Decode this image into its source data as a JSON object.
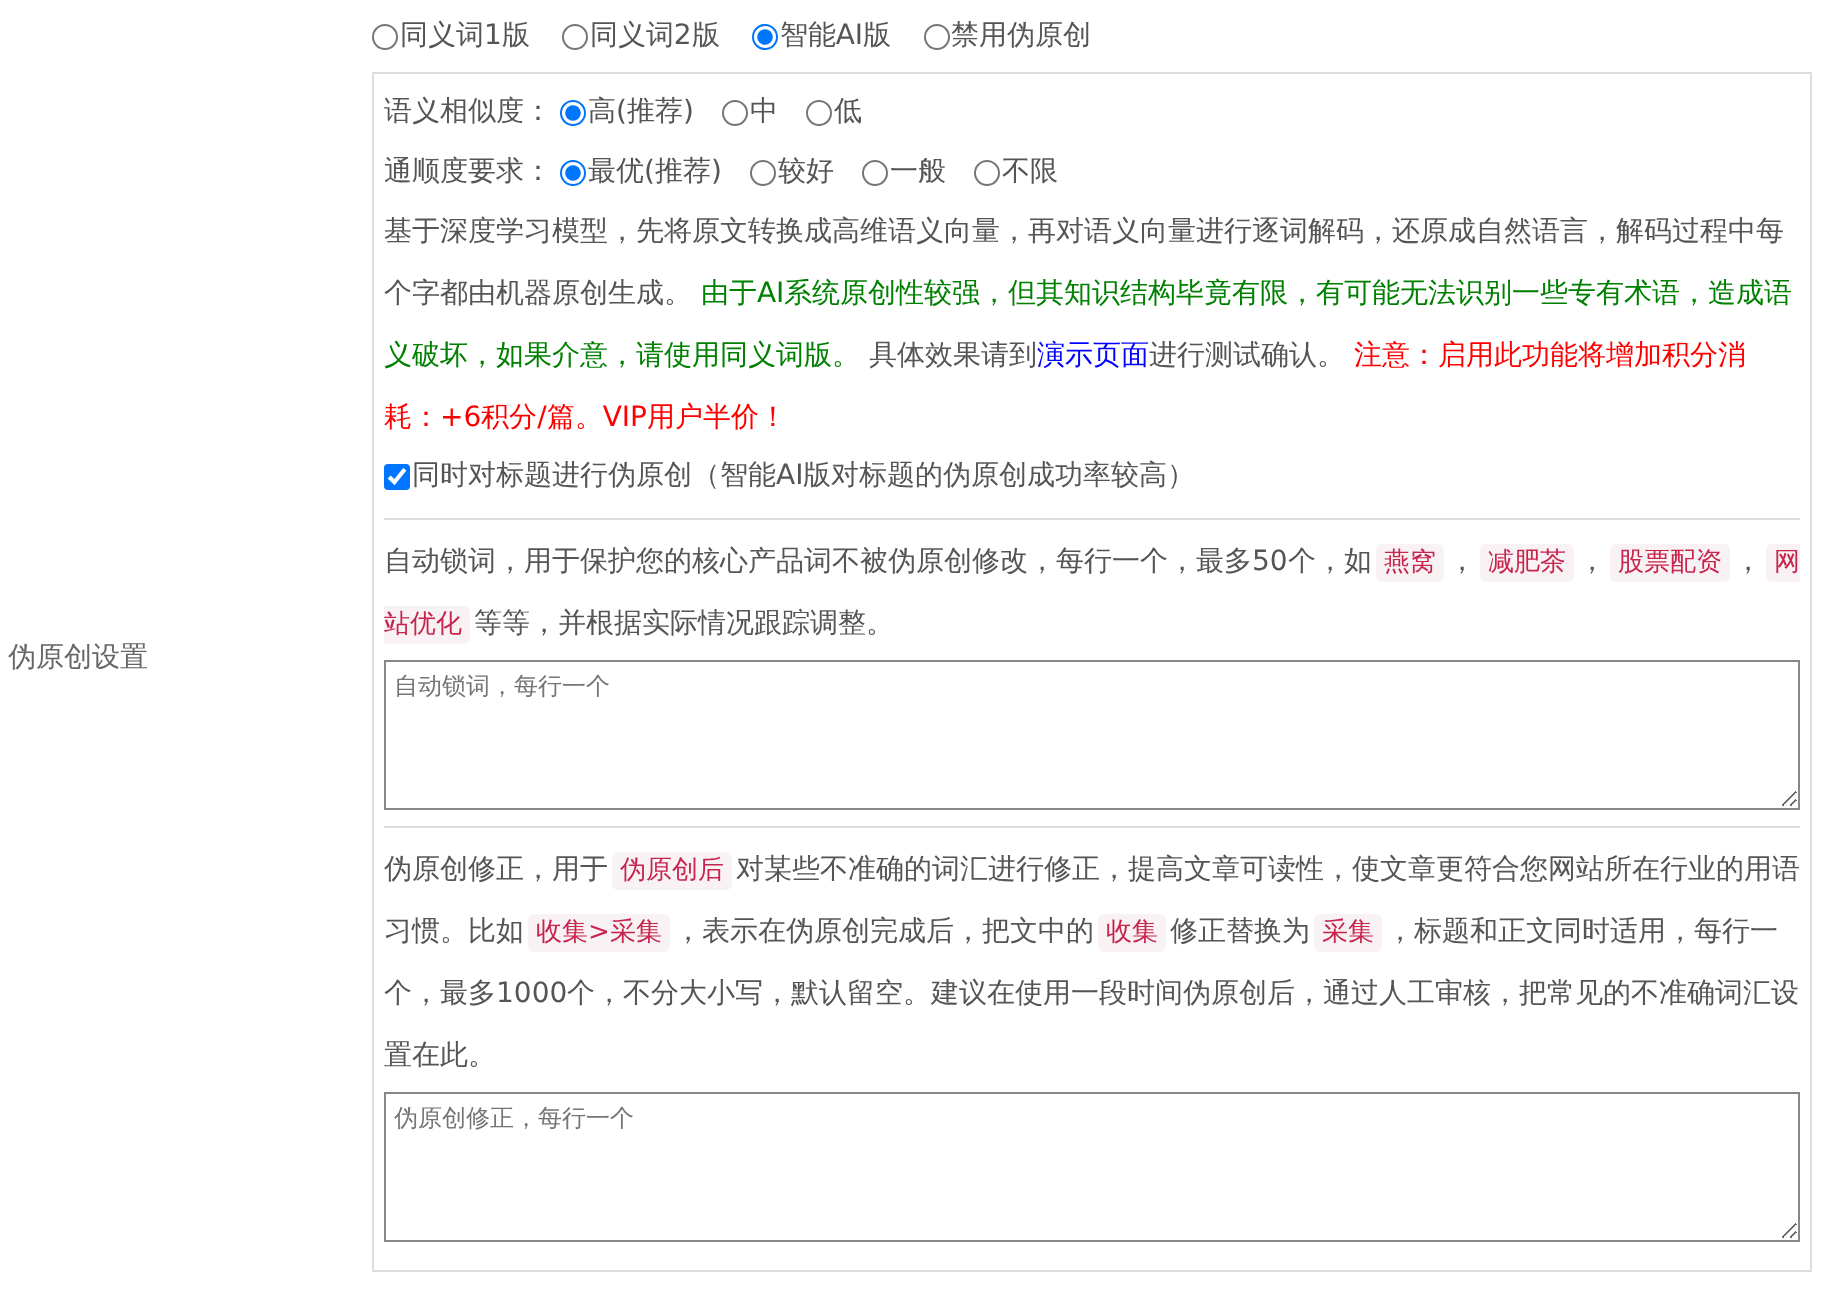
{
  "section_label": "伪原创设置",
  "modes": [
    {
      "label": "同义词1版",
      "selected": false
    },
    {
      "label": "同义词2版",
      "selected": false
    },
    {
      "label": "智能AI版",
      "selected": true
    },
    {
      "label": "禁用伪原创",
      "selected": false
    }
  ],
  "settings": [
    {
      "label": "语义相似度：",
      "options": [
        {
          "label": "高(推荐)",
          "selected": true
        },
        {
          "label": "中",
          "selected": false
        },
        {
          "label": "低",
          "selected": false
        }
      ]
    },
    {
      "label": "通顺度要求：",
      "options": [
        {
          "label": "最优(推荐)",
          "selected": true
        },
        {
          "label": "较好",
          "selected": false
        },
        {
          "label": "一般",
          "selected": false
        },
        {
          "label": "不限",
          "selected": false
        }
      ]
    }
  ],
  "description": [
    {
      "kind": "plain",
      "text": "基于深度学习模型，先将原文转换成高维语义向量，再对语义向量进行逐词解码，还原成自然语言，解码过程中每个字都由机器原创生成。 "
    },
    {
      "kind": "green",
      "text": "由于AI系统原创性较强，但其知识结构毕竟有限，有可能无法识别一些专有术语，造成语义破坏，如果介意，请使用同义词版。"
    },
    {
      "kind": "plain",
      "text": " 具体效果请到"
    },
    {
      "kind": "link",
      "text": "演示页面"
    },
    {
      "kind": "plain",
      "text": "进行测试确认。 "
    },
    {
      "kind": "red",
      "text": "注意：启用此功能将增加积分消耗：+6积分/篇。VIP用户半价！"
    }
  ],
  "title_option": {
    "label": "同时对标题进行伪原创（智能AI版对标题的伪原创成功率较高）",
    "checked": true
  },
  "lock_words": {
    "description": [
      {
        "kind": "plain",
        "text": "自动锁词，用于保护您的核心产品词不被伪原创修改，每行一个，最多50个，如"
      },
      {
        "kind": "tag",
        "text": "燕窝"
      },
      {
        "kind": "plain",
        "text": "，"
      },
      {
        "kind": "tag",
        "text": "减肥茶"
      },
      {
        "kind": "plain",
        "text": "，"
      },
      {
        "kind": "tag",
        "text": "股票配资"
      },
      {
        "kind": "plain",
        "text": "，"
      },
      {
        "kind": "tag",
        "text": "网站优化"
      },
      {
        "kind": "plain",
        "text": "等等，并根据实际情况跟踪调整。"
      }
    ],
    "placeholder": "自动锁词，每行一个"
  },
  "corrections": {
    "description": [
      {
        "kind": "plain",
        "text": "伪原创修正，用于"
      },
      {
        "kind": "tag",
        "text": "伪原创后"
      },
      {
        "kind": "plain",
        "text": "对某些不准确的词汇进行修正，提高文章可读性，使文章更符合您网站所在行业的用语习惯。比如"
      },
      {
        "kind": "tag",
        "text": "收集>采集"
      },
      {
        "kind": "plain",
        "text": "，表示在伪原创完成后，把文中的"
      },
      {
        "kind": "tag",
        "text": "收集"
      },
      {
        "kind": "plain",
        "text": "修正替换为"
      },
      {
        "kind": "tag",
        "text": "采集"
      },
      {
        "kind": "plain",
        "text": "，标题和正文同时适用，每行一个，最多1000个，不分大小写，默认留空。建议在使用一段时间伪原创后，通过人工审核，把常见的不准确词汇设置在此。"
      }
    ],
    "placeholder": "伪原创修正，每行一个"
  }
}
